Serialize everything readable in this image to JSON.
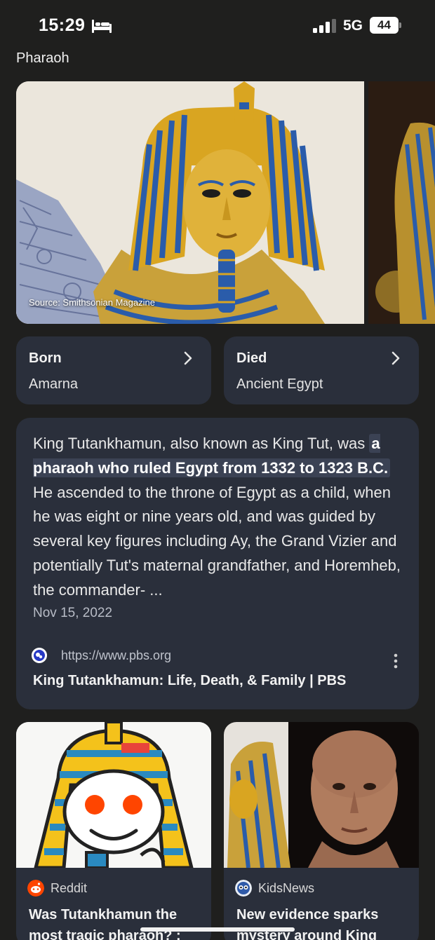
{
  "status_bar": {
    "time": "15:29",
    "network": "5G",
    "battery": "44",
    "icons": [
      "sleep-bed-icon",
      "cellular-signal-icon",
      "battery-icon"
    ]
  },
  "section_title": "Pharaoh",
  "carousel": {
    "source_caption": "Source: Smithsonian Magazine"
  },
  "facts": [
    {
      "label": "Born",
      "value": "Amarna",
      "icon": "chevron-right-icon"
    },
    {
      "label": "Died",
      "value": "Ancient Egypt",
      "icon": "chevron-right-icon"
    }
  ],
  "snippet": {
    "text_before": "King Tutankhamun, also known as King Tut, was ",
    "highlight": "a pharaoh who ruled Egypt from 1332 to 1323 B.C.",
    "text_after": " He ascended to the throne of Egypt as a child, when he was eight or nine years old, and was guided by several key figures including Ay, the Grand Vizier and potentially Tut's maternal grandfather, and Horemheb, the commander- ...",
    "date": "Nov 15, 2022",
    "source_url": "https://www.pbs.org",
    "title": "King Tutankhamun: Life, Death, & Family | PBS",
    "icons": [
      "pbs-logo-icon",
      "more-vert-icon"
    ]
  },
  "results": [
    {
      "site": "Reddit",
      "title": "Was Tutankhamun the most tragic pharaoh? :",
      "icon": "reddit-logo-icon"
    },
    {
      "site": "KidsNews",
      "title": "New evidence sparks mystery around King",
      "icon": "kidsnews-logo-icon"
    }
  ],
  "colors": {
    "background": "#1f1f1e",
    "card": "#2a2f3b",
    "highlight": "#3b4254",
    "reddit": "#ff4500",
    "gold": "#d9a521",
    "lapis": "#2a5caa"
  }
}
